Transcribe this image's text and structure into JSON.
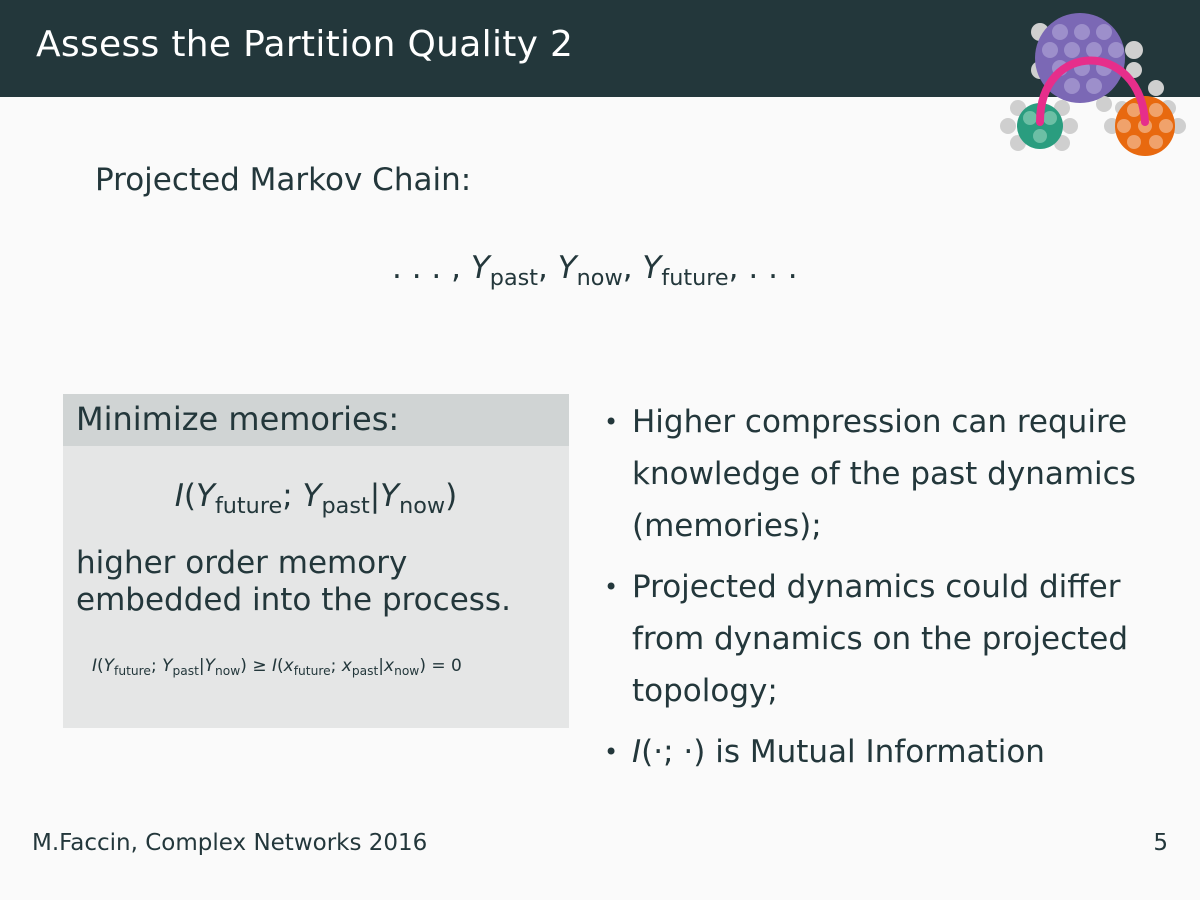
{
  "header": {
    "title": "Assess the Partition Quality 2"
  },
  "logo": {
    "icon": "network-communities-logo",
    "colors": [
      "#7b68b5",
      "#2a9d7f",
      "#e8690f",
      "#e62e8b",
      "#c8c8c8"
    ]
  },
  "main": {
    "subtitle": "Projected Markov Chain:",
    "chain": {
      "lead": ". . . , ",
      "y1": "Y",
      "s1": "past",
      "c1": ", ",
      "y2": "Y",
      "s2": "now",
      "c2": ", ",
      "y3": "Y",
      "s3": "future",
      "tail": ", . . ."
    }
  },
  "block": {
    "title": "Minimize memories:",
    "formula": {
      "I": "I",
      "open": "(",
      "y1": "Y",
      "s1": "future",
      "semi": "; ",
      "y2": "Y",
      "s2": "past",
      "bar": "|",
      "y3": "Y",
      "s3": "now",
      "close": ")"
    },
    "text": "higher order memory embedded into the process.",
    "inequality": {
      "I1": "I",
      "o1": "(",
      "a": "Y",
      "as": "future",
      "sc1": "; ",
      "b": "Y",
      "bs": "past",
      "bar1": "|",
      "c": "Y",
      "cs": "now",
      "cl1": ")",
      "geq": " ≥ ",
      "I2": "I",
      "o2": "(",
      "d": "x",
      "ds": "future",
      "sc2": "; ",
      "e": "x",
      "es": "past",
      "bar2": "|",
      "f": "x",
      "fs": "now",
      "cl2": ")",
      "eq": " = 0"
    }
  },
  "bullets": {
    "dot": "•",
    "b1": "Higher compression can require knowledge of the past dynamics (memories);",
    "b2": "Projected dynamics could differ from dynamics on the projected topology;",
    "b3_I": "I",
    "b3_math": "(·; ·)",
    "b3_text": " is Mutual Information"
  },
  "footer": {
    "left": "M.Faccin, Complex Networks 2016",
    "page": "5"
  }
}
